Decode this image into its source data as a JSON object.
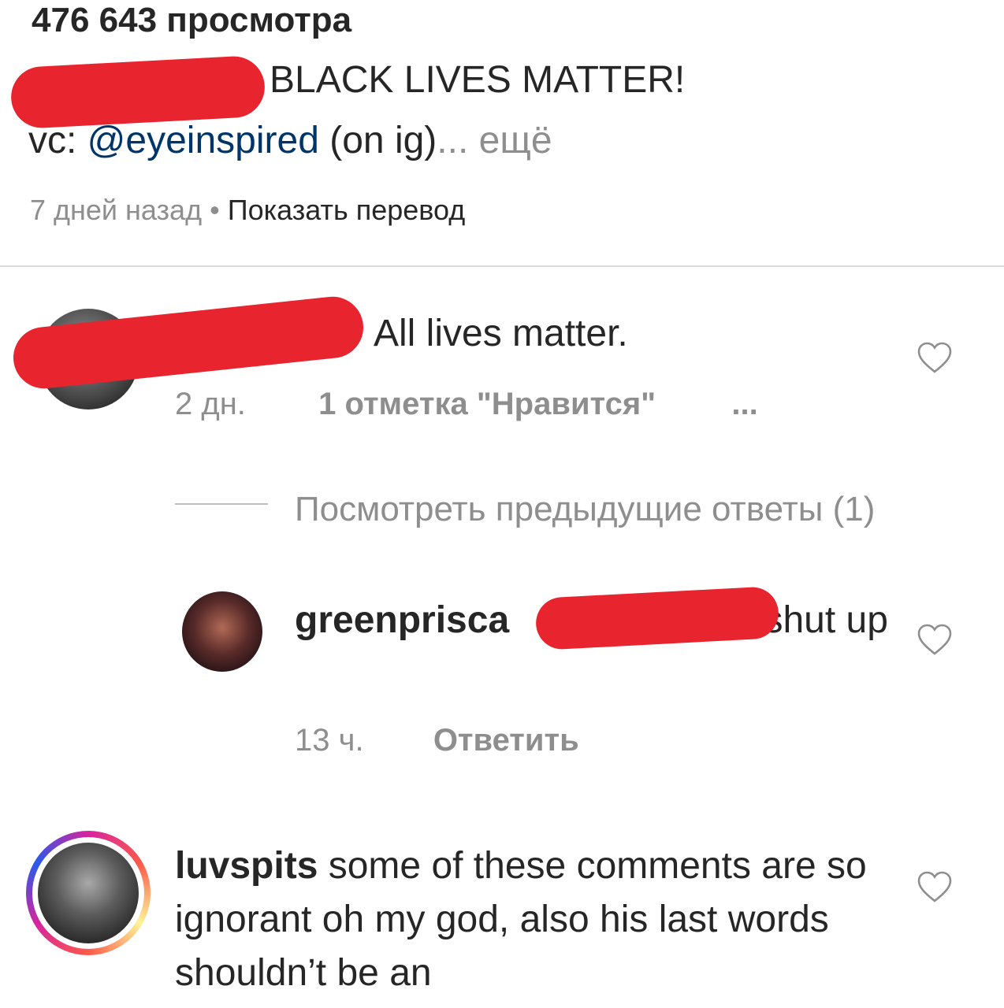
{
  "post": {
    "views": "476 643 просмотра",
    "caption_text": "BLACK LIVES MATTER!",
    "caption_vc_prefix": "vc: ",
    "caption_mention": "@eyeinspired",
    "caption_suffix": " (on ig)",
    "caption_more": "... ещё",
    "time_ago": "7 дней назад",
    "meta_separator": " • ",
    "show_translation": "Показать перевод"
  },
  "comments": [
    {
      "text": "All lives matter.",
      "time": "2 дн.",
      "likes": "1 отметка \"Нравится\"",
      "more": "..."
    },
    {
      "view_replies": "Посмотреть предыдущие ответы (1)",
      "username": "greenprisca",
      "text": " shut up",
      "time": "13 ч.",
      "reply": "Ответить"
    },
    {
      "username": "luvspits",
      "text": " some of these comments are so ignorant oh my god, also his last words shouldn’t be an"
    }
  ],
  "icons": {
    "like": "heart-outline-icon",
    "redaction": "red-scribble"
  },
  "colors": {
    "redaction": "#e8242f",
    "mention": "#003569",
    "secondary_text": "#8e8e8e",
    "primary_text": "#262626"
  }
}
